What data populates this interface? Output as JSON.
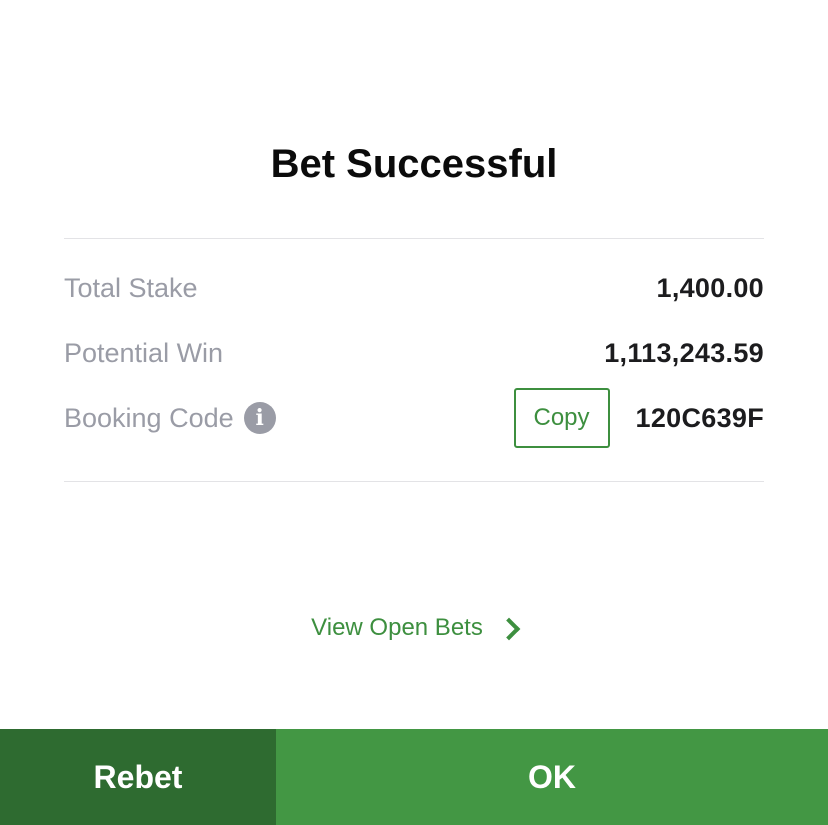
{
  "dialog": {
    "title": "Bet Successful"
  },
  "summary": {
    "total_stake_label": "Total Stake",
    "total_stake_value": "1,400.00",
    "potential_win_label": "Potential Win",
    "potential_win_value": "1,113,243.59",
    "booking_code_label": "Booking Code",
    "booking_code_info_icon": "info-icon",
    "copy_label": "Copy",
    "booking_code_value": "120C639F"
  },
  "links": {
    "view_open_bets": "View Open Bets",
    "chevron_icon": "chevron-right-icon"
  },
  "footer": {
    "rebet_label": "Rebet",
    "ok_label": "OK"
  },
  "colors": {
    "accent_green": "#439744",
    "dark_green": "#2e6b30",
    "link_green": "#3d8f3f",
    "muted_label": "#9a9ca6"
  }
}
